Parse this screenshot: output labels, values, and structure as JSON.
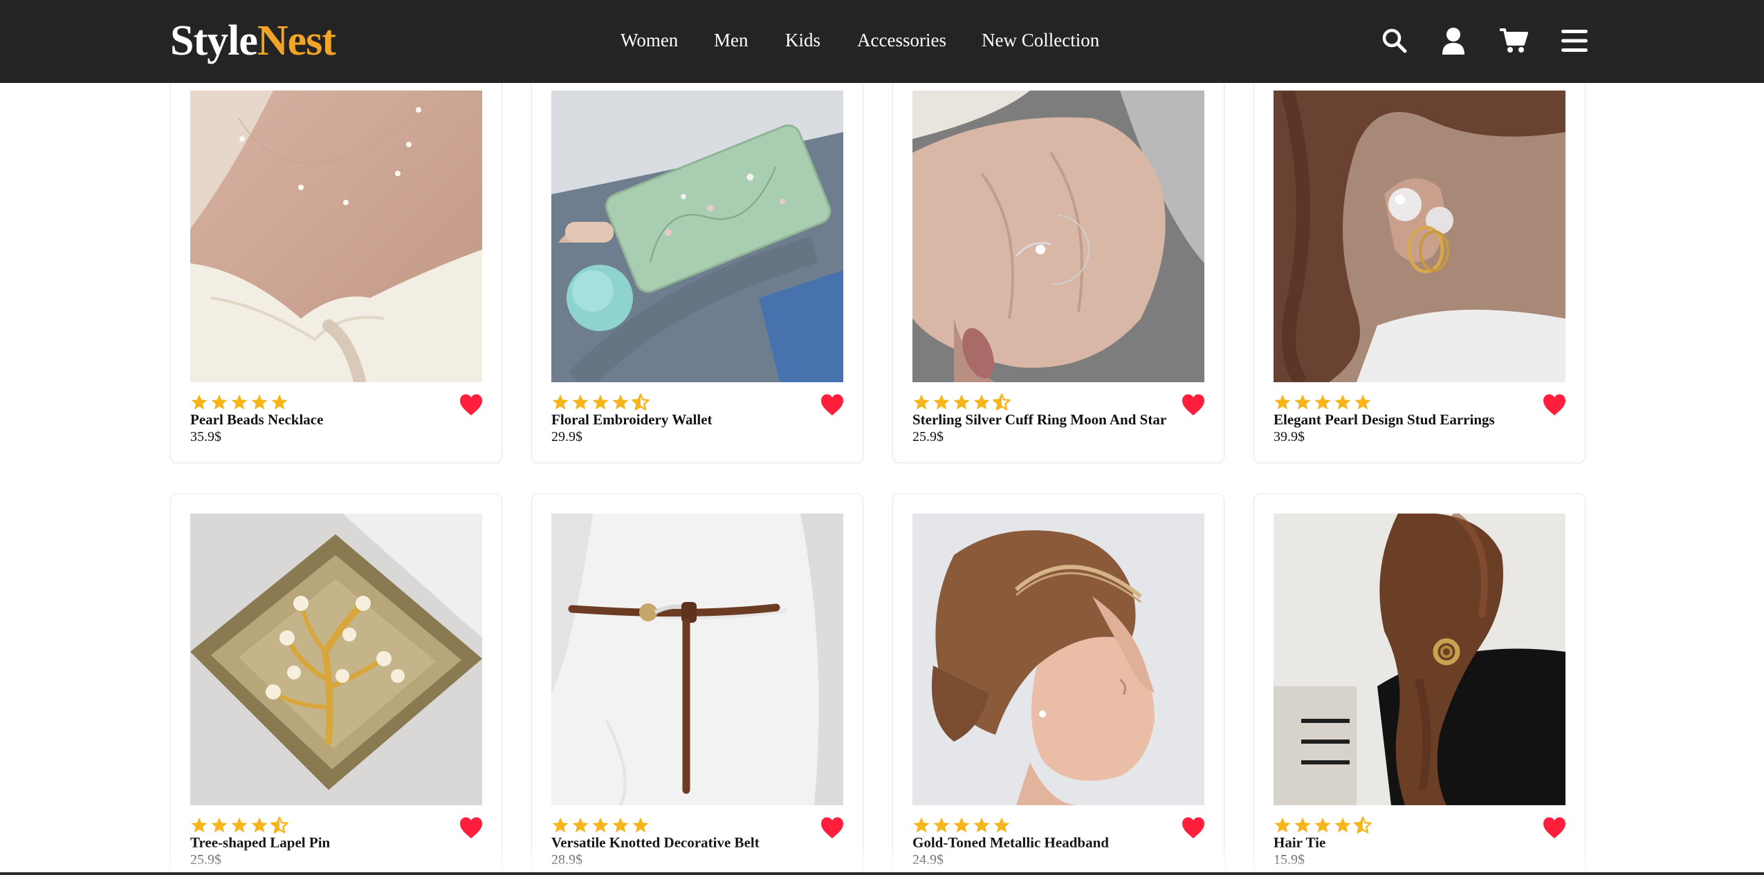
{
  "brand": {
    "part1": "Style",
    "part2": "Nest",
    "accent_color": "#f0a527"
  },
  "nav": {
    "links": [
      "Women",
      "Men",
      "Kids",
      "Accessories",
      "New Collection"
    ],
    "icons": [
      "search-icon",
      "user-icon",
      "cart-icon",
      "menu-icon"
    ]
  },
  "colors": {
    "navbar_bg": "#242424",
    "star": "#f7b51c",
    "heart": "#ff1f3d"
  },
  "products": [
    {
      "name": "Pearl Beads Necklace",
      "price": "35.9$",
      "rating": 5
    },
    {
      "name": "Floral Embroidery Wallet",
      "price": "29.9$",
      "rating": 4.5
    },
    {
      "name": "Sterling Silver Cuff Ring Moon And Star",
      "price": "25.9$",
      "rating": 4.5
    },
    {
      "name": "Elegant Pearl Design Stud Earrings",
      "price": "39.9$",
      "rating": 5
    },
    {
      "name": "Tree-shaped Lapel Pin",
      "price": "25.9$",
      "rating": 4.5
    },
    {
      "name": "Versatile Knotted Decorative Belt",
      "price": "28.9$",
      "rating": 5
    },
    {
      "name": "Gold-Toned Metallic Headband",
      "price": "24.9$",
      "rating": 5
    },
    {
      "name": "Hair Tie",
      "price": "15.9$",
      "rating": 4.5
    }
  ]
}
